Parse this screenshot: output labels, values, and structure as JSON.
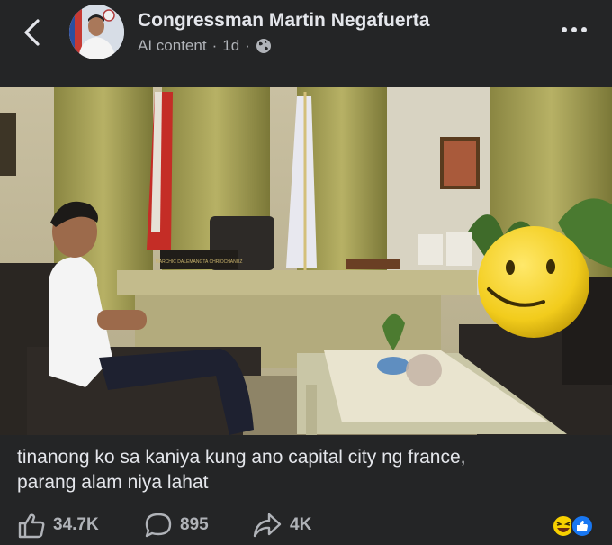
{
  "header": {
    "author_name": "Congressman Martin Negafuerta",
    "label": "AI content",
    "time": "1d",
    "separator": "·",
    "audience_icon": "globe-icon",
    "back_icon": "chevron-left-icon",
    "more_icon": "more-horizontal-icon"
  },
  "post": {
    "caption_lines": [
      "tinanong ko sa kaniya kung ano capital city ng france,",
      "parang alam niya lahat"
    ],
    "desk_nameplate": "MARCHIC DALEMANGTA CHRIOCHANUZ"
  },
  "actions": {
    "likes": "34.7K",
    "comments": "895",
    "shares": "4K",
    "like_icon": "thumbs-up-icon",
    "comment_icon": "comment-bubble-icon",
    "share_icon": "share-arrow-icon",
    "reaction_icons": [
      "laugh-emoji-icon",
      "like-reaction-icon"
    ]
  },
  "colors": {
    "background": "#242526",
    "text_primary": "#e4e6eb",
    "text_secondary": "#b0b3b8",
    "like_blue": "#1877f2",
    "emoji_yellow": "#f7d000"
  }
}
